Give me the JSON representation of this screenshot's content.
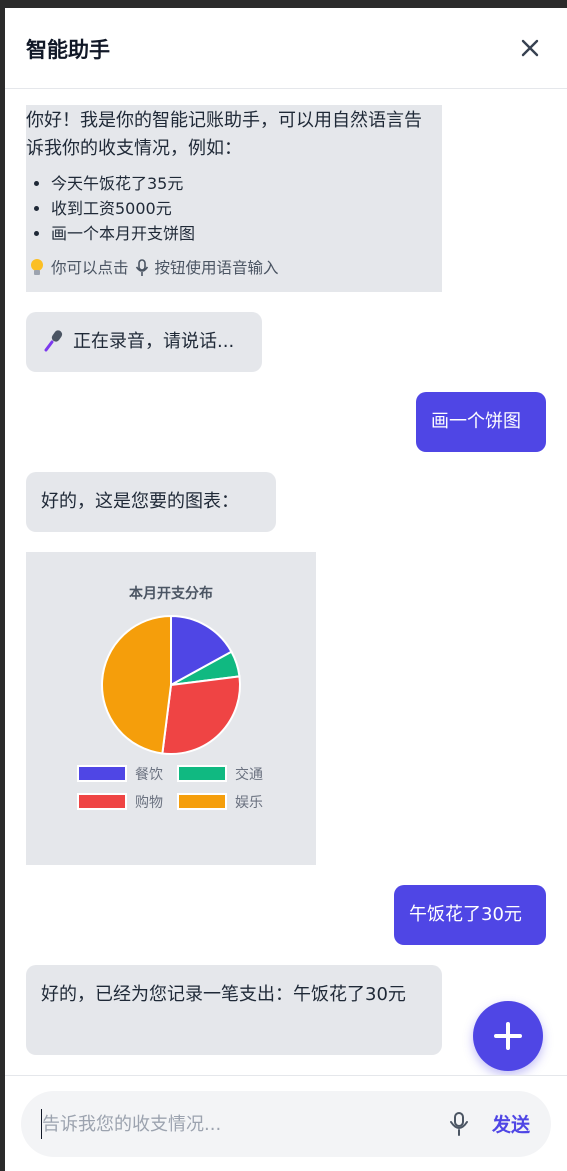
{
  "header": {
    "title": "智能助手",
    "close_icon": "close-icon"
  },
  "messages": {
    "welcome": {
      "intro": "你好！我是你的智能记账助手，可以用自然语言告诉我你的收支情况，例如：",
      "examples": [
        "今天午饭花了35元",
        "收到工资5000元",
        "画一个本月开支饼图"
      ],
      "tip_before": "你可以点击",
      "tip_after": "按钮使用语音输入",
      "tip_icon": "lightbulb-icon"
    },
    "recording": {
      "icon": "microphone-emoji-icon",
      "text": "正在录音，请说话..."
    },
    "user_1": "画一个饼图",
    "reply_1": "好的，这是您要的图表：",
    "user_2": "午饭花了30元",
    "reply_2": "好的，已经为您记录一笔支出：午饭花了30元"
  },
  "chart_data": {
    "type": "pie",
    "title": "本月开支分布",
    "categories": [
      "餐饮",
      "交通",
      "购物",
      "娱乐"
    ],
    "values": [
      17,
      6,
      29,
      48
    ],
    "colors": [
      "#4f46e5",
      "#10b981",
      "#ef4444",
      "#f59e0b"
    ],
    "legend": "bottom"
  },
  "footer": {
    "placeholder": "告诉我您的收支情况...",
    "value": "",
    "send_label": "发送",
    "mic_icon": "microphone-icon"
  },
  "fab": {
    "icon": "plus-icon"
  },
  "colors": {
    "accent": "#4f46e5",
    "bubble_ai": "#e5e7eb"
  }
}
